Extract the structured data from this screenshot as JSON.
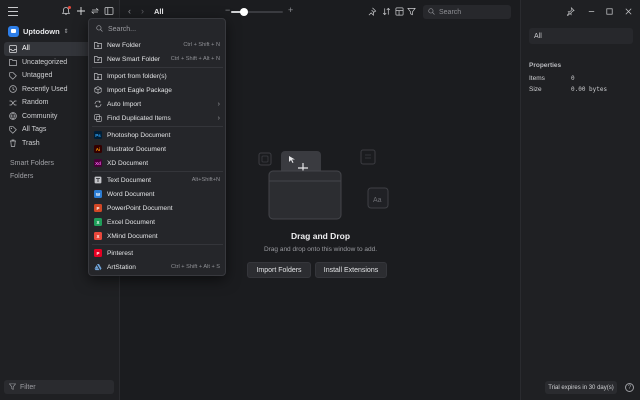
{
  "colors": {
    "accent": "#2d7ee8",
    "notification_dot": "#e8473b",
    "photoshop": "#31a8ff",
    "illustrator": "#ff9a00",
    "xd": "#ff61f6",
    "word": "#2b7cd3",
    "powerpoint": "#d24726",
    "excel": "#1f9e5a",
    "xmind": "#e8473b",
    "pinterest": "#e60023"
  },
  "sidebar": {
    "library_name": "Uptodown",
    "items": [
      {
        "label": "All",
        "icon": "inbox-icon"
      },
      {
        "label": "Uncategorized",
        "icon": "folder-question-icon"
      },
      {
        "label": "Untagged",
        "icon": "tag-off-icon"
      },
      {
        "label": "Recently Used",
        "icon": "clock-icon"
      },
      {
        "label": "Random",
        "icon": "shuffle-icon"
      },
      {
        "label": "Community",
        "icon": "globe-icon"
      },
      {
        "label": "All Tags",
        "icon": "tag-icon"
      },
      {
        "label": "Trash",
        "icon": "trash-icon"
      }
    ],
    "smart_folders_label": "Smart Folders",
    "folders_label": "Folders",
    "filter_placeholder": "Filter"
  },
  "toolbar": {
    "title": "All",
    "zoom_level": 0.25,
    "search_placeholder": "Search"
  },
  "menu": {
    "search_placeholder": "Search...",
    "groups": [
      [
        {
          "label": "New Folder",
          "shortcut": "Ctrl + Shift + N",
          "icon": "folder-plus-icon"
        },
        {
          "label": "New Smart Folder",
          "shortcut": "Ctrl + Shift + Alt + N",
          "icon": "smart-folder-icon"
        }
      ],
      [
        {
          "label": "Import from folder(s)",
          "shortcut": "",
          "icon": "folder-import-icon"
        },
        {
          "label": "Import Eagle Package",
          "shortcut": "",
          "icon": "package-icon"
        },
        {
          "label": "Auto Import",
          "shortcut": "",
          "icon": "auto-import-icon",
          "submenu": true
        },
        {
          "label": "Find Duplicated Items",
          "shortcut": "",
          "icon": "duplicate-icon",
          "submenu": true
        }
      ],
      [
        {
          "label": "Photoshop Document",
          "shortcut": "",
          "app": "Ps",
          "color": "#31a8ff",
          "bg": "#001e36"
        },
        {
          "label": "Illustrator Document",
          "shortcut": "",
          "app": "Ai",
          "color": "#ff9a00",
          "bg": "#330000"
        },
        {
          "label": "XD Document",
          "shortcut": "",
          "app": "Xd",
          "color": "#ff61f6",
          "bg": "#470137"
        }
      ],
      [
        {
          "label": "Text Document",
          "shortcut": "Alt+Shift+N",
          "icon": "text-doc-icon"
        },
        {
          "label": "Word Document",
          "shortcut": "",
          "app": "W",
          "color": "#ffffff",
          "bg": "#2b7cd3"
        },
        {
          "label": "PowerPoint Document",
          "shortcut": "",
          "app": "P",
          "color": "#ffffff",
          "bg": "#d24726"
        },
        {
          "label": "Excel Document",
          "shortcut": "",
          "app": "X",
          "color": "#ffffff",
          "bg": "#1f9e5a"
        },
        {
          "label": "XMind Document",
          "shortcut": "",
          "app": "X",
          "color": "#ffffff",
          "bg": "#e8473b"
        }
      ],
      [
        {
          "label": "Pinterest",
          "shortcut": "",
          "app": "P",
          "color": "#ffffff",
          "bg": "#e60023"
        },
        {
          "label": "ArtStation",
          "shortcut": "Ctrl + Shift + Alt + S",
          "icon": "artstation-icon"
        }
      ]
    ]
  },
  "empty_state": {
    "title": "Drag and Drop",
    "subtitle": "Drag and drop onto this window to add.",
    "import_folders": "Import Folders",
    "install_extensions": "Install Extensions"
  },
  "inspector": {
    "name_value": "All",
    "properties_title": "Properties",
    "items_label": "Items",
    "items_value": "0",
    "size_label": "Size",
    "size_value": "0.00 bytes",
    "trial_text": "Trial expires in 30 day(s)",
    "help_label": "?"
  }
}
